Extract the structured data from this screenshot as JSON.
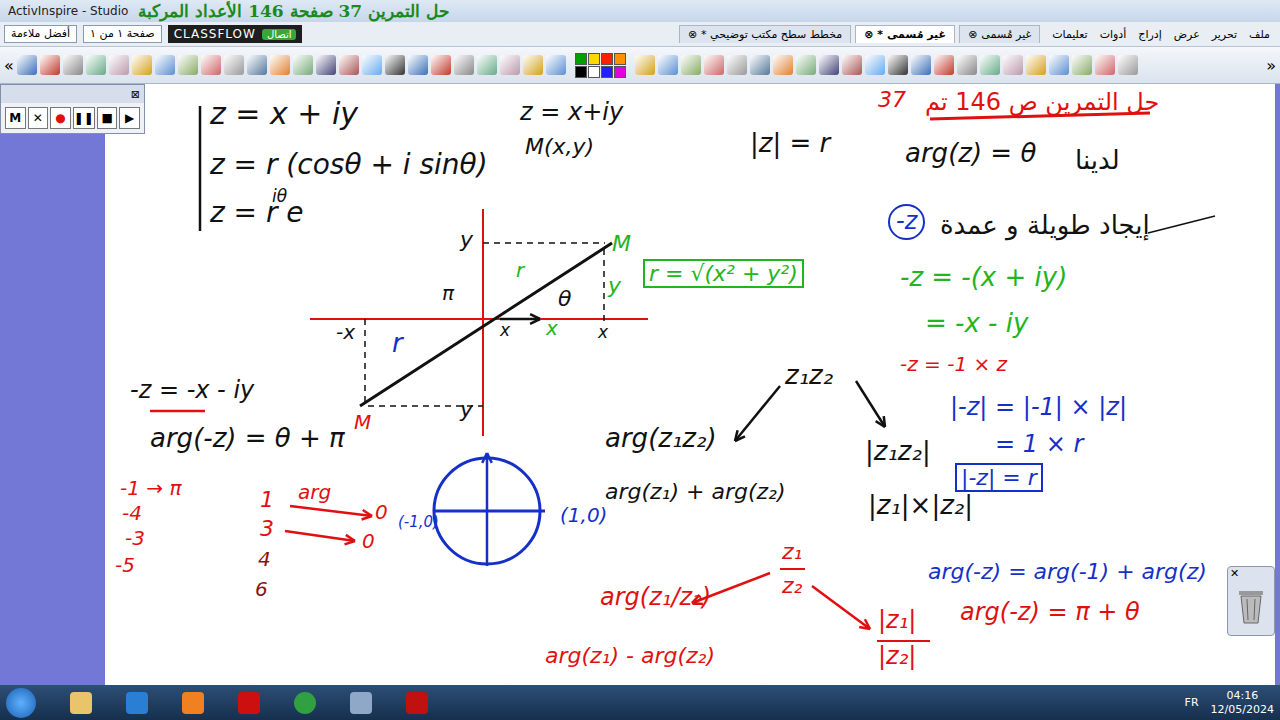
{
  "window": {
    "app": "ActivInspire - Studio",
    "title": "حل التمرين 37 صفحة 146 الأعداد المركبة"
  },
  "zoom": {
    "value": "أفضل ملاءمة"
  },
  "page": {
    "label": "صفحة ١ من ١"
  },
  "classflow": {
    "logo": "CLASSFLOW",
    "button": "اتصال"
  },
  "tabs": [
    {
      "label": "مخطط سطح مكتب توضيحي *",
      "selected": false,
      "close": "⊗"
    },
    {
      "label": "غير مُسمى *",
      "selected": true,
      "close": "⊗"
    },
    {
      "label": "غير مُسمى",
      "selected": false,
      "close": "⊗"
    }
  ],
  "menu": [
    "ملف",
    "تحرير",
    "عرض",
    "إدراج",
    "أدوات",
    "تعليمات"
  ],
  "toolbar": {
    "left": "«",
    "right": "»",
    "palette": [
      {
        "color": "#00a000"
      },
      {
        "color": "#ffd800"
      },
      {
        "color": "#ff2000"
      },
      {
        "color": "#ff9000"
      },
      {
        "color": "#000000"
      },
      {
        "color": "#ffffff"
      },
      {
        "color": "#2020ff"
      },
      {
        "color": "#e000e0"
      }
    ]
  },
  "recorder": {
    "close": "⊠",
    "buttons": [
      {
        "label": "M"
      },
      {
        "label": "✕"
      },
      {
        "label": "●"
      },
      {
        "label": "❚❚"
      },
      {
        "label": "■"
      },
      {
        "label": "▶"
      }
    ]
  },
  "trash": {
    "close": "✕"
  },
  "notes": [
    {
      "text": "37",
      "color": "#e01010",
      "kind": "plain"
    },
    {
      "text": "حل التمرين ص 146 تم",
      "color": "#e01010",
      "kind": "plain"
    },
    {
      "text": "z = x + iy",
      "color": "#111111",
      "kind": "plain"
    },
    {
      "text": "z = r (cosθ + i sinθ)",
      "color": "#111111",
      "kind": "plain"
    },
    {
      "text": "z = r e",
      "color": "#111111",
      "kind": "plain"
    },
    {
      "text": "iθ",
      "color": "#111111",
      "kind": "plain"
    },
    {
      "text": "z = x+iy",
      "color": "#111111",
      "kind": "plain"
    },
    {
      "text": "M(x,y)",
      "color": "#111111",
      "kind": "plain"
    },
    {
      "text": "|z| = r",
      "color": "#111111",
      "kind": "plain"
    },
    {
      "text": "arg(z) = θ",
      "color": "#111111",
      "kind": "plain"
    },
    {
      "text": "لدينا",
      "color": "#111111",
      "kind": "plain"
    },
    {
      "text": "-z",
      "color": "#1530c8",
      "kind": "circled"
    },
    {
      "text": "إيجاد طويلة و عمدة",
      "color": "#111111",
      "kind": "plain"
    },
    {
      "text": "-z = -(x + iy)",
      "color": "#22b522",
      "kind": "plain"
    },
    {
      "text": "= -x - iy",
      "color": "#22b522",
      "kind": "plain"
    },
    {
      "text": "-z = -1 × z",
      "color": "#e01010",
      "kind": "plain"
    },
    {
      "text": "|-z| = |-1| × |z|",
      "color": "#1530c8",
      "kind": "plain"
    },
    {
      "text": "= 1 × r",
      "color": "#1530c8",
      "kind": "plain"
    },
    {
      "text": "|-z| = r",
      "color": "#1530c8",
      "kind": "boxed"
    },
    {
      "text": "z₁z₂",
      "color": "#111111",
      "kind": "plain"
    },
    {
      "text": "arg(z₁z₂)",
      "color": "#111111",
      "kind": "plain"
    },
    {
      "text": "arg(z₁) + arg(z₂)",
      "color": "#111111",
      "kind": "plain"
    },
    {
      "text": "|z₁z₂|",
      "color": "#111111",
      "kind": "plain"
    },
    {
      "text": "|z₁|×|z₂|",
      "color": "#111111",
      "kind": "plain"
    },
    {
      "text": "-z = -x - iy",
      "color": "#111111",
      "kind": "plain"
    },
    {
      "text": "arg(-z) = θ + π",
      "color": "#111111",
      "kind": "plain"
    },
    {
      "text": "-1 → π",
      "color": "#e01010",
      "kind": "plain"
    },
    {
      "text": "-4",
      "color": "#e01010",
      "kind": "plain"
    },
    {
      "text": "-3",
      "color": "#e01010",
      "kind": "plain"
    },
    {
      "text": "-5",
      "color": "#e01010",
      "kind": "plain"
    },
    {
      "text": "1",
      "color": "#e01010",
      "kind": "plain"
    },
    {
      "text": "arg",
      "color": "#e01010",
      "kind": "plain"
    },
    {
      "text": "0",
      "color": "#e01010",
      "kind": "plain"
    },
    {
      "text": "3",
      "color": "#e01010",
      "kind": "plain"
    },
    {
      "text": "0",
      "color": "#e01010",
      "kind": "plain"
    },
    {
      "text": "4",
      "color": "#8a1010",
      "kind": "plain"
    },
    {
      "text": "6",
      "color": "#8a1010",
      "kind": "plain"
    },
    {
      "text": "(-1,0)",
      "color": "#1530c8",
      "kind": "plain"
    },
    {
      "text": "(1,0)",
      "color": "#1530c8",
      "kind": "plain"
    },
    {
      "text": "z₁",
      "color": "#e01010",
      "kind": "plain"
    },
    {
      "text": "z₂",
      "color": "#e01010",
      "kind": "plain"
    },
    {
      "text": "arg(z₁/z₂)",
      "color": "#e01010",
      "kind": "plain"
    },
    {
      "text": "arg(z₁) - arg(z₂)",
      "color": "#e01010",
      "kind": "plain"
    },
    {
      "text": "|z₁|",
      "color": "#e01010",
      "kind": "plain"
    },
    {
      "text": "|z₂|",
      "color": "#e01010",
      "kind": "plain"
    },
    {
      "text": "arg(-z) = arg(-1) + arg(z)",
      "color": "#1530c8",
      "kind": "plain"
    },
    {
      "text": "arg(-z) = π + θ",
      "color": "#e01010",
      "kind": "plain"
    },
    {
      "text": "r = √(x² + y²)",
      "color": "#22b522",
      "kind": "boxed"
    },
    {
      "text": "y",
      "color": "#111111",
      "kind": "plain"
    },
    {
      "text": "M",
      "color": "#22b522",
      "kind": "plain"
    },
    {
      "text": "y",
      "color": "#22b522",
      "kind": "plain"
    },
    {
      "text": "r",
      "color": "#22b522",
      "kind": "plain"
    },
    {
      "text": "θ",
      "color": "#111111",
      "kind": "plain"
    },
    {
      "text": "π",
      "color": "#111111",
      "kind": "plain"
    },
    {
      "text": "x",
      "color": "#22b522",
      "kind": "plain"
    },
    {
      "text": "x",
      "color": "#111111",
      "kind": "plain"
    },
    {
      "text": "-x",
      "color": "#111111",
      "kind": "plain"
    },
    {
      "text": "r",
      "color": "#1530c8",
      "kind": "plain"
    },
    {
      "text": "y",
      "color": "#111111",
      "kind": "plain"
    },
    {
      "text": "M",
      "color": "#e01010",
      "kind": "plain"
    },
    {
      "text": "x",
      "color": "#111111",
      "kind": "plain"
    }
  ],
  "taskbar": {
    "lang": "FR",
    "time": "04:16",
    "date": "12/05/2024"
  }
}
